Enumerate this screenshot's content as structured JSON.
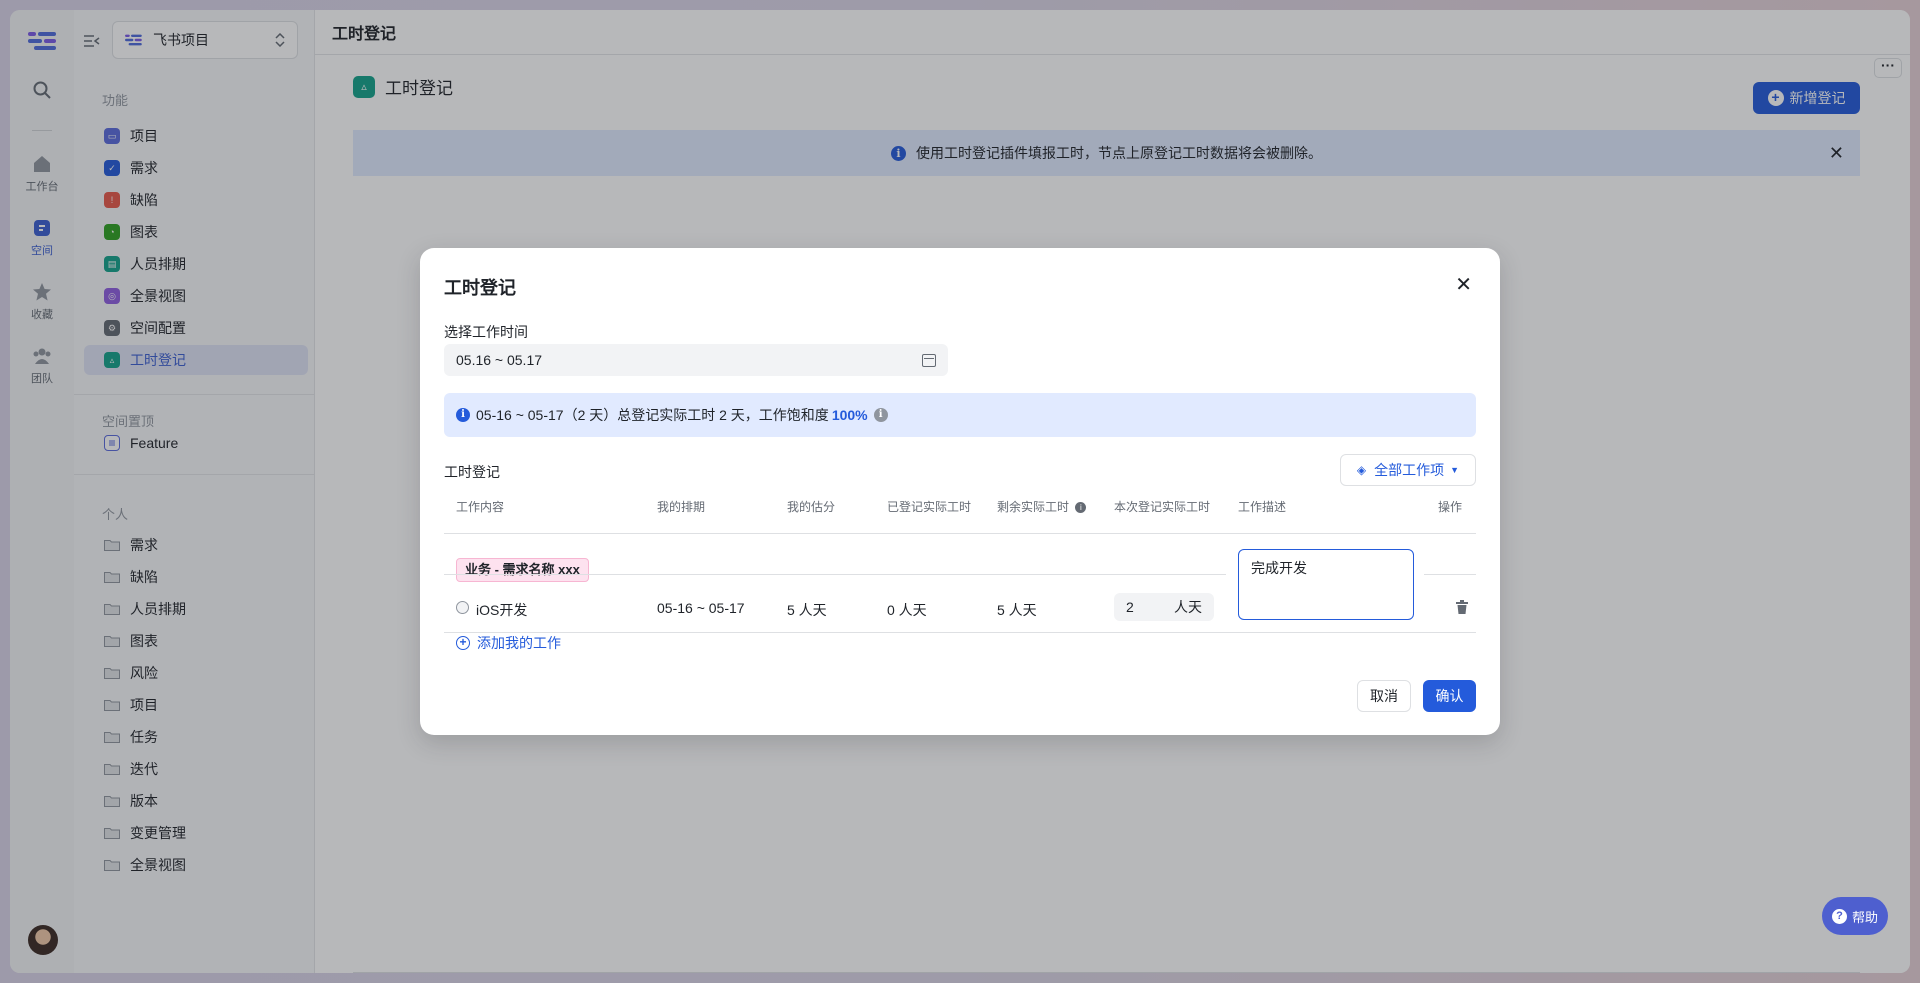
{
  "topbar": {
    "title": "工时登记"
  },
  "project_switcher": {
    "name": "飞书项目"
  },
  "rail": {
    "items": [
      {
        "label": "工作台",
        "icon": "home-icon"
      },
      {
        "label": "空间",
        "icon": "space-icon"
      },
      {
        "label": "收藏",
        "icon": "star-icon"
      },
      {
        "label": "团队",
        "icon": "team-icon"
      }
    ]
  },
  "sidebar": {
    "section_features": "功能",
    "features": [
      {
        "label": "项目",
        "color": "#5b6bdc"
      },
      {
        "label": "需求",
        "color": "#245bdb"
      },
      {
        "label": "缺陷",
        "color": "#e8594a"
      },
      {
        "label": "图表",
        "color": "#2ea121"
      },
      {
        "label": "人员排期",
        "color": "#14a38b"
      },
      {
        "label": "全景视图",
        "color": "#8f5fe0"
      },
      {
        "label": "空间配置",
        "color": "#646a73"
      },
      {
        "label": "工时登记",
        "color": "#14a38b"
      }
    ],
    "section_pinned": "空间置顶",
    "pinned": [
      {
        "label": "Feature"
      }
    ],
    "section_personal": "个人",
    "personal": [
      {
        "label": "需求"
      },
      {
        "label": "缺陷"
      },
      {
        "label": "人员排期"
      },
      {
        "label": "图表"
      },
      {
        "label": "风险"
      },
      {
        "label": "项目"
      },
      {
        "label": "任务"
      },
      {
        "label": "迭代"
      },
      {
        "label": "版本"
      },
      {
        "label": "变更管理"
      },
      {
        "label": "全景视图"
      }
    ]
  },
  "page": {
    "title": "工时登记",
    "new_button": "新增登记",
    "banner": "使用工时登记插件填报工时，节点上原登记工时数据将会被删除。",
    "help": "帮助"
  },
  "modal": {
    "title": "工时登记",
    "time_label": "选择工作时间",
    "date_range": "05.16 ~ 05.17",
    "summary_text": "05-16 ~ 05-17（2 天）总登记实际工时 2 天，工作饱和度",
    "summary_pct": "100%",
    "section_label": "工时登记",
    "filter_label": "全部工作项",
    "columns": [
      "工作内容",
      "我的排期",
      "我的估分",
      "已登记实际工时",
      "剩余实际工时",
      "本次登记实际工时",
      "工作描述",
      "操作"
    ],
    "group_tag": "业务 - 需求名称 xxx",
    "row": {
      "name": "iOS开发",
      "schedule": "05-16 ~ 05-17",
      "estimate": "5 人天",
      "logged": "0 人天",
      "remaining": "5 人天",
      "current_value": "2",
      "current_unit": "人天",
      "description": "完成开发"
    },
    "add_work": "添加我的工作",
    "cancel": "取消",
    "confirm": "确认"
  },
  "colors": {
    "primary": "#245bdb",
    "active_bg": "#dfe3f5",
    "tag_bg": "#fde2ef"
  }
}
